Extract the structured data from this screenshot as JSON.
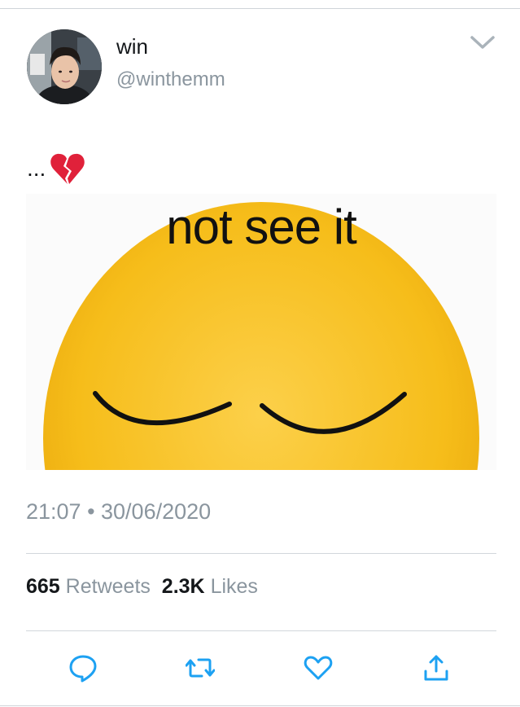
{
  "user": {
    "display_name": "win",
    "handle": "@winthemm"
  },
  "tweet": {
    "text": "...",
    "emoji": "broken-heart-icon",
    "media_caption": "not see it",
    "timestamp": "21:07 • 30/06/2020"
  },
  "stats": {
    "retweets_count": "665",
    "retweets_label": "Retweets",
    "likes_count": "2.3K",
    "likes_label": "Likes"
  },
  "actions": [
    "reply-icon",
    "retweet-icon",
    "like-icon",
    "share-icon"
  ],
  "colors": {
    "secondary_text": "#8a959e",
    "icon_blue": "#1da1f2",
    "emoji_yellow": "#f5c21b",
    "heart_red": "#e0213a"
  }
}
